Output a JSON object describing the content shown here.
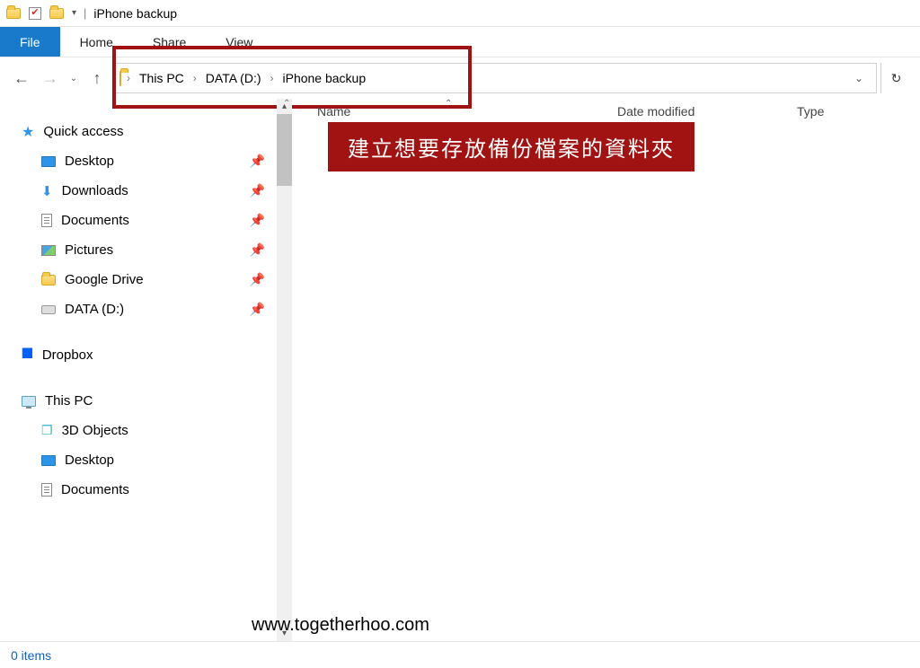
{
  "window_title": "iPhone backup",
  "ribbon": {
    "file": "File",
    "tabs": [
      "Home",
      "Share",
      "View"
    ]
  },
  "breadcrumbs": [
    "This PC",
    "DATA (D:)",
    "iPhone backup"
  ],
  "nav": {
    "quick_access": "Quick access",
    "quick_items": [
      {
        "label": "Desktop",
        "icon": "desktop"
      },
      {
        "label": "Downloads",
        "icon": "downloads"
      },
      {
        "label": "Documents",
        "icon": "doc"
      },
      {
        "label": "Pictures",
        "icon": "pic"
      },
      {
        "label": "Google Drive",
        "icon": "folder"
      },
      {
        "label": "DATA (D:)",
        "icon": "drive"
      }
    ],
    "dropbox": "Dropbox",
    "this_pc": "This PC",
    "pc_items": [
      {
        "label": "3D Objects",
        "icon": "cube"
      },
      {
        "label": "Desktop",
        "icon": "desktop"
      },
      {
        "label": "Documents",
        "icon": "doc"
      }
    ]
  },
  "columns": {
    "name": "Name",
    "date": "Date modified",
    "type": "Type"
  },
  "annotation": "建立想要存放備份檔案的資料夾",
  "status": "0 items",
  "watermark": "www.togetherhoo.com"
}
